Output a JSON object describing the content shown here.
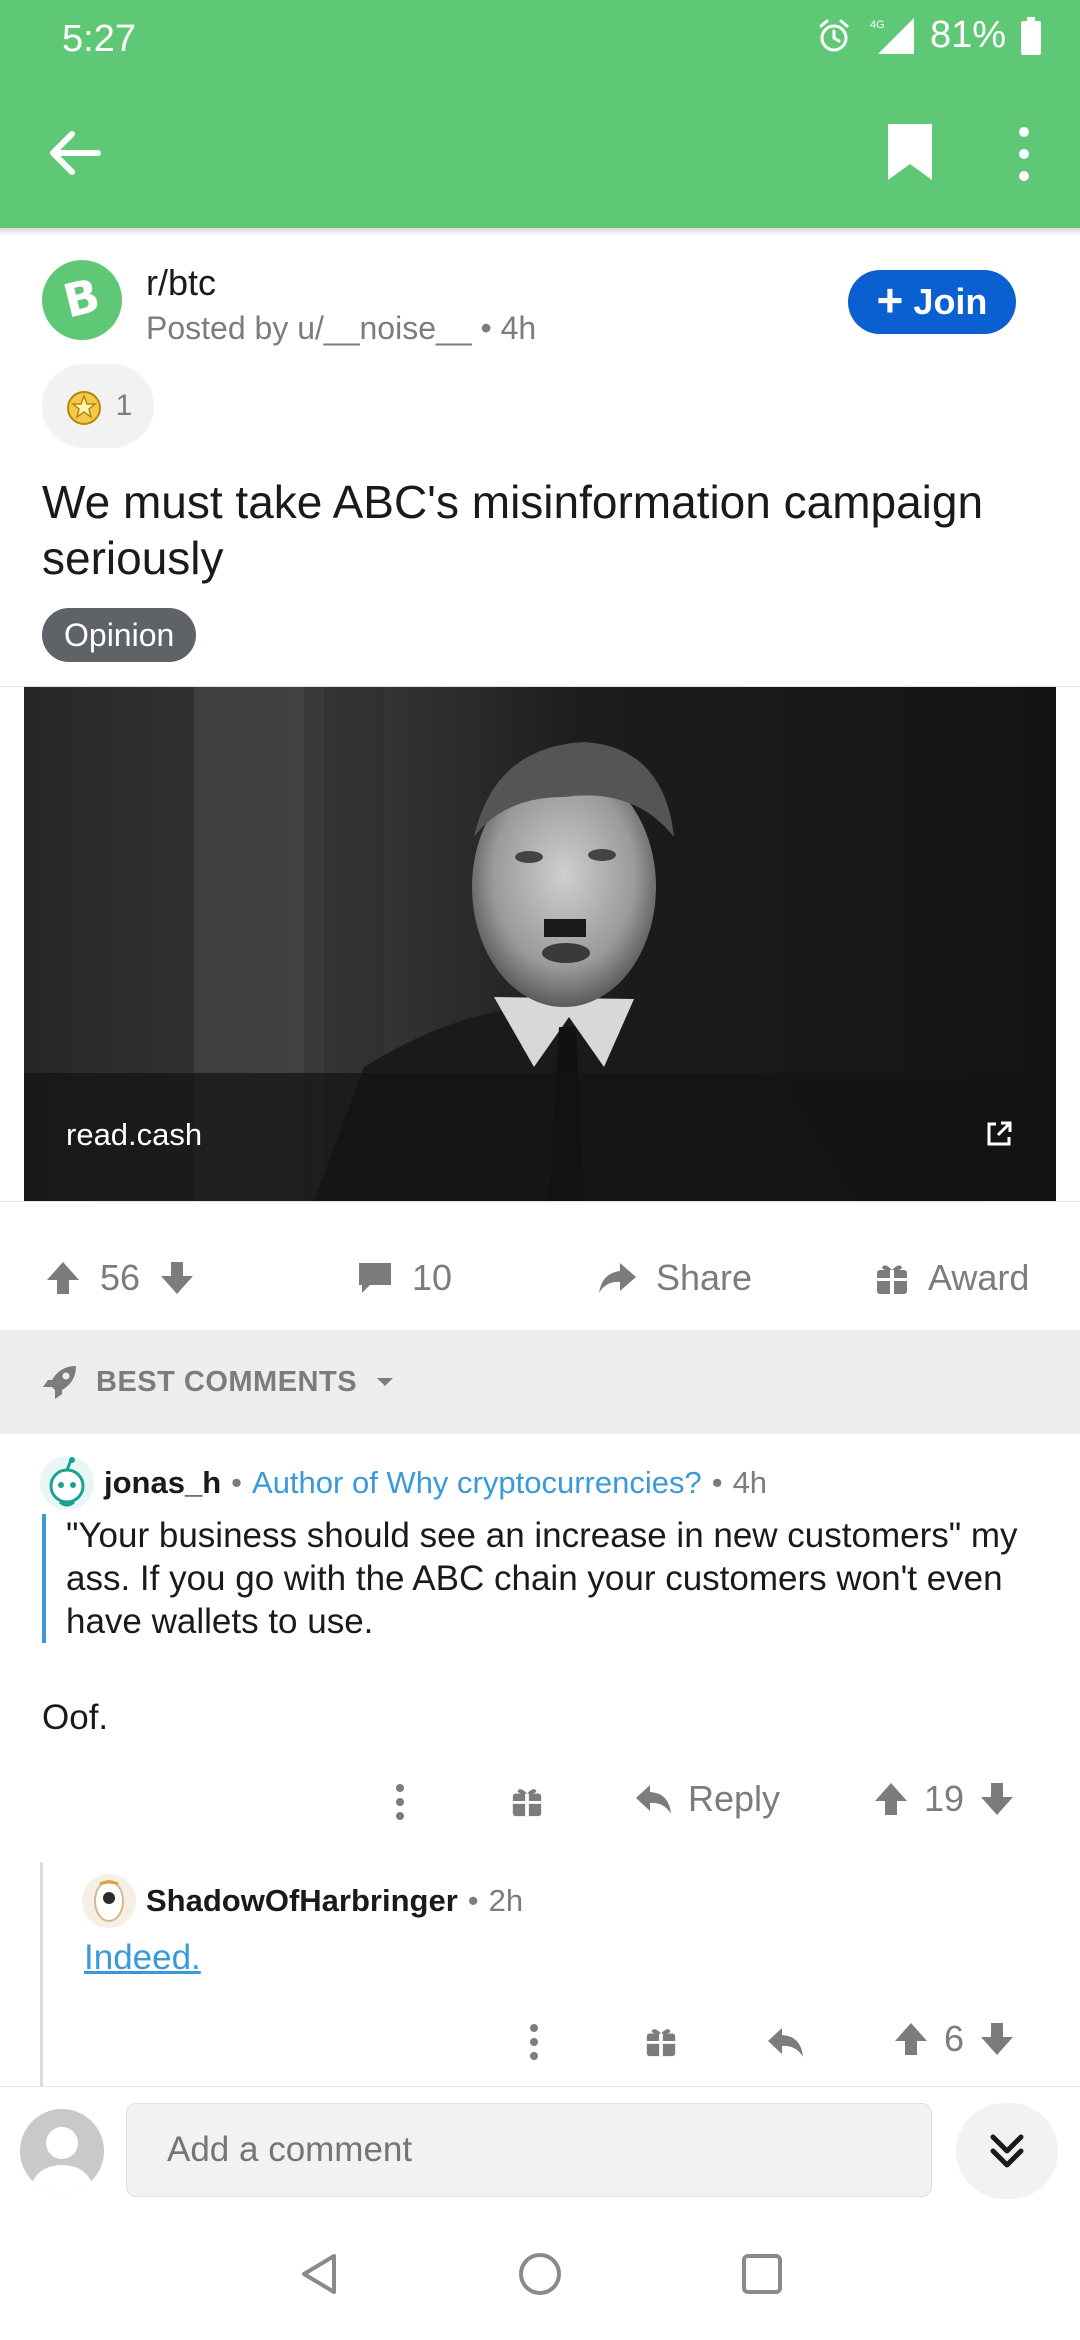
{
  "status_bar": {
    "time": "5:27",
    "battery": "81%",
    "network": "4G"
  },
  "app_bar": {
    "back_icon": "arrow-left-icon",
    "bookmark_icon": "bookmark-icon",
    "more_icon": "more-vert-icon"
  },
  "post": {
    "subreddit": "r/btc",
    "posted_by": "Posted by u/__noise__ • 4h",
    "join_label": "Join",
    "award_count": "1",
    "title": "We must take ABC's misinformation campaign seriously",
    "flair": "Opinion",
    "link_domain": "read.cash",
    "upvotes": "56",
    "comments": "10",
    "share_label": "Share",
    "award_label": "Award"
  },
  "sort": {
    "label": "BEST COMMENTS"
  },
  "comments": [
    {
      "user": "jonas_h",
      "flair": "Author of Why cryptocurrencies?",
      "time": "4h",
      "quote": "\"Your business should see an increase in new customers\" my ass. If you go with the ABC chain your customers won't even have wallets to use.",
      "text": "Oof.",
      "reply_label": "Reply",
      "score": "19"
    },
    {
      "user": "ShadowOfHarbringer",
      "time": "2h",
      "text": "Indeed.",
      "score": "6"
    }
  ],
  "comment_bar": {
    "placeholder": "Add a comment"
  },
  "colors": {
    "brand_green": "#5fc877",
    "join_blue": "#0a5fd1",
    "link_blue": "#3a9ad9",
    "meta_gray": "#7c7c7c"
  }
}
